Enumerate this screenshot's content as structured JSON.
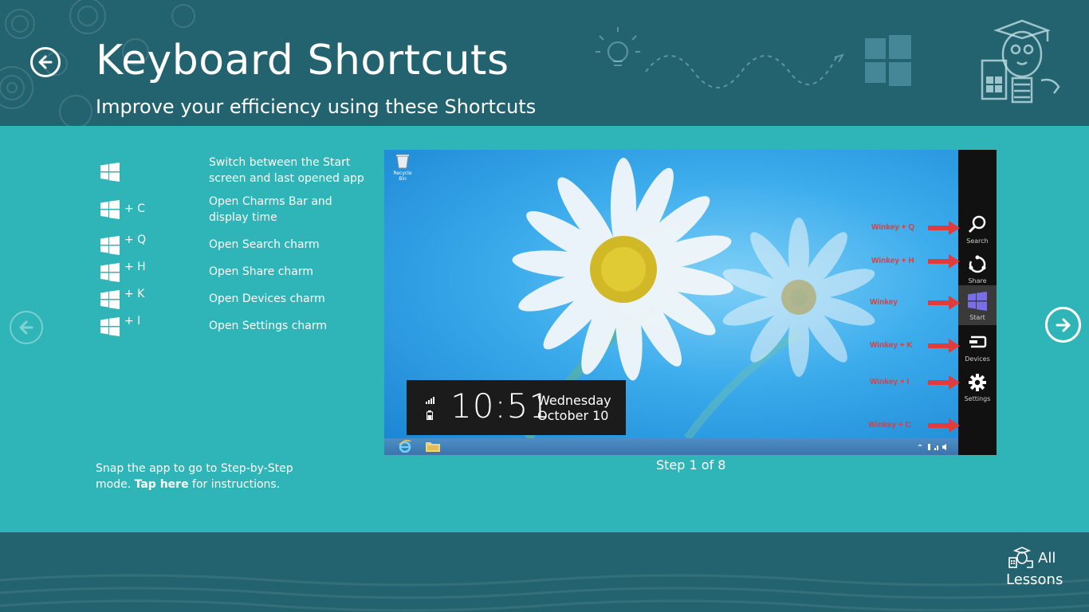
{
  "header": {
    "title": "Keyboard Shortcuts",
    "subtitle": "Improve your efficiency using these Shortcuts"
  },
  "shortcuts": [
    {
      "key": "",
      "description": "Switch between the Start screen and last opened app"
    },
    {
      "key": "+ C",
      "description": "Open Charms Bar and display time"
    },
    {
      "key": "+ Q",
      "description": "Open Search charm"
    },
    {
      "key": "+ H",
      "description": "Open Share charm"
    },
    {
      "key": "+ K",
      "description": "Open Devices charm"
    },
    {
      "key": "+ I",
      "description": "Open Settings charm"
    }
  ],
  "snap": {
    "text_before": "Snap the app to go to Step-by-Step mode. ",
    "link": "Tap here",
    "text_after": " for instructions."
  },
  "screenshot": {
    "recycle_label": "Recycle Bin",
    "clock": {
      "time": "10:51",
      "day": "Wednesday",
      "date": "October 10"
    },
    "charms": [
      {
        "label": "Search",
        "annotation": "Winkey + Q",
        "icon": "search-icon"
      },
      {
        "label": "Share",
        "annotation": "Winkey + H",
        "icon": "share-icon"
      },
      {
        "label": "Start",
        "annotation": "Winkey",
        "icon": "windows-logo-icon"
      },
      {
        "label": "Devices",
        "annotation": "Winkey + K",
        "icon": "devices-icon"
      },
      {
        "label": "Settings",
        "annotation": "Winkey + I",
        "icon": "gear-icon"
      }
    ],
    "charms_bar_annotation": "Winkey + C"
  },
  "step": "Step 1 of 8",
  "footer": {
    "all_lessons_1": "All",
    "all_lessons_2": "Lessons"
  },
  "colors": {
    "header": "#23636f",
    "body": "#2fb5b7",
    "charm_start": "#7a6ee6",
    "annotation": "#e23b3b"
  }
}
